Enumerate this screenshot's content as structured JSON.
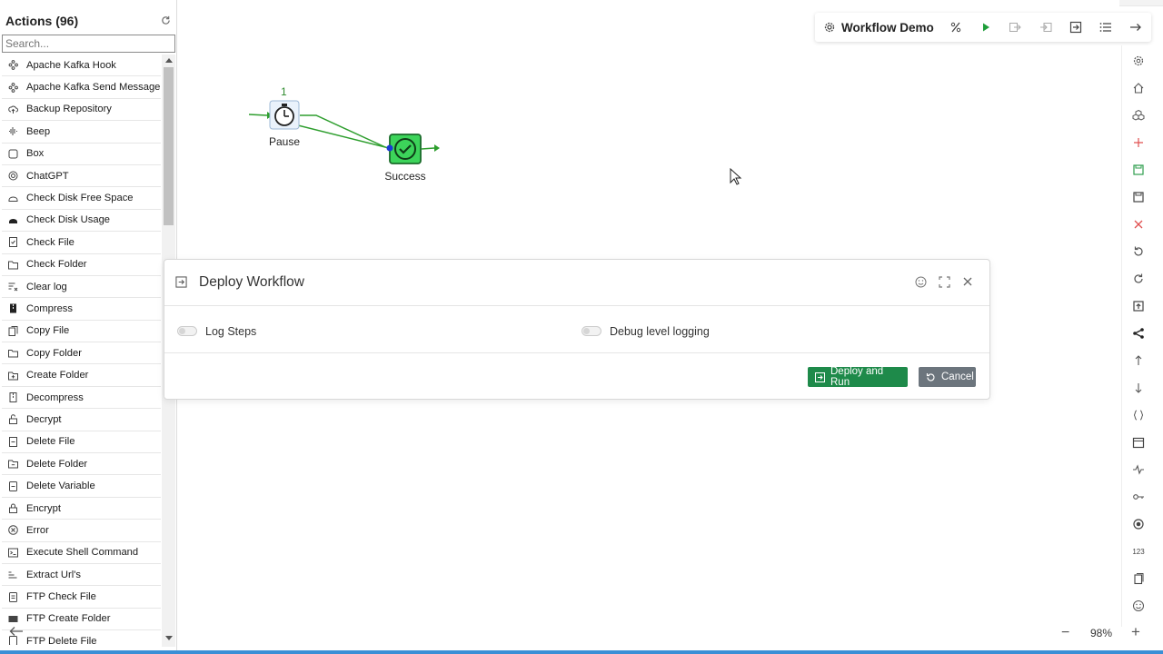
{
  "sidebar": {
    "title": "Actions (96)",
    "search_placeholder": "Search...",
    "actions": [
      {
        "label": "Apache Kafka Hook",
        "icon": "kafka-icon"
      },
      {
        "label": "Apache Kafka Send Message",
        "icon": "kafka-icon"
      },
      {
        "label": "Backup Repository",
        "icon": "cloud-upload-icon"
      },
      {
        "label": "Beep",
        "icon": "sound-wave-icon"
      },
      {
        "label": "Box",
        "icon": "square-icon"
      },
      {
        "label": "ChatGPT",
        "icon": "openai-icon"
      },
      {
        "label": "Check Disk Free Space",
        "icon": "disk-icon"
      },
      {
        "label": "Check Disk Usage",
        "icon": "disk-filled-icon"
      },
      {
        "label": "Check File",
        "icon": "file-check-icon"
      },
      {
        "label": "Check Folder",
        "icon": "folder-check-icon"
      },
      {
        "label": "Clear log",
        "icon": "clear-list-icon"
      },
      {
        "label": "Compress",
        "icon": "zip-icon"
      },
      {
        "label": "Copy File",
        "icon": "copy-file-icon"
      },
      {
        "label": "Copy Folder",
        "icon": "copy-folder-icon"
      },
      {
        "label": "Create Folder",
        "icon": "folder-plus-icon"
      },
      {
        "label": "Decompress",
        "icon": "unzip-icon"
      },
      {
        "label": "Decrypt",
        "icon": "unlock-icon"
      },
      {
        "label": "Delete File",
        "icon": "file-minus-icon"
      },
      {
        "label": "Delete Folder",
        "icon": "folder-minus-icon"
      },
      {
        "label": "Delete Variable",
        "icon": "variable-minus-icon"
      },
      {
        "label": "Encrypt",
        "icon": "lock-icon"
      },
      {
        "label": "Error",
        "icon": "error-circle-icon"
      },
      {
        "label": "Execute Shell Command",
        "icon": "terminal-icon"
      },
      {
        "label": "Extract Url's",
        "icon": "extract-icon"
      },
      {
        "label": "FTP Check File",
        "icon": "ftp-file-icon"
      },
      {
        "label": "FTP Create Folder",
        "icon": "ftp-folder-icon"
      },
      {
        "label": "FTP Delete File",
        "icon": "ftp-delete-icon"
      }
    ]
  },
  "canvas": {
    "nodes": [
      {
        "label": "Pause",
        "badge": "1",
        "icon": "stopwatch-icon"
      },
      {
        "label": "Success",
        "icon": "check-circle-icon"
      }
    ]
  },
  "toolbar": {
    "workflow_name": "Workflow Demo",
    "buttons": [
      "percent-icon",
      "play-icon",
      "export-icon",
      "import-icon",
      "deploy-icon",
      "list-icon",
      "arrow-right-icon"
    ]
  },
  "rail": {
    "buttons": [
      "gear-icon",
      "home-icon",
      "cubes-icon",
      "plus-icon",
      "save-green-icon",
      "save-icon",
      "close-icon",
      "undo-icon",
      "redo-icon",
      "upload-icon",
      "share-icon",
      "arrow-up-icon",
      "arrow-down-icon",
      "braces-icon",
      "calendar-icon",
      "pulse-icon",
      "key-icon",
      "target-icon",
      "numbers-icon",
      "copy-icon",
      "smile-icon"
    ],
    "numbers_label": "123"
  },
  "zoom": {
    "minus": "−",
    "value": "98%",
    "plus": "+"
  },
  "modal": {
    "title": "Deploy Workflow",
    "option_log_steps": "Log Steps",
    "option_debug": "Debug level logging",
    "deploy_label": "Deploy and Run",
    "cancel_label": "Cancel"
  },
  "colors": {
    "deploy_green": "#1e8a4a",
    "cancel_gray": "#6c757d",
    "flow_green": "#2e9e2e",
    "node_green": "#3cd45a"
  }
}
